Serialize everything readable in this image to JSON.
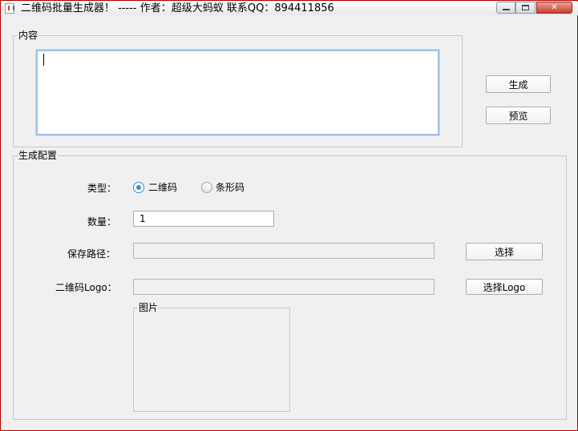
{
  "window": {
    "title": "二维码批量生成器！  ----- 作者：超级大蚂蚁       联系QQ：894411856"
  },
  "content_group": {
    "title": "内容",
    "text_value": ""
  },
  "actions": {
    "generate_label": "生成",
    "preview_label": "预览"
  },
  "config_group": {
    "title": "生成配置",
    "type_label": "类型：",
    "type_options": [
      {
        "label": "二维码",
        "checked": true
      },
      {
        "label": "条形码",
        "checked": false
      }
    ],
    "count_label": "数量：",
    "count_value": "1",
    "path_label": "保存路径：",
    "path_value": "",
    "choose_label": "选择",
    "logo_label": "二维码Logo：",
    "logo_value": "",
    "choose_logo_label": "选择Logo",
    "image_group_title": "图片"
  },
  "colors": {
    "focus_border": "#9cc2e5",
    "radio_selected": "#3b86d6",
    "close_button": "#c7412c"
  }
}
